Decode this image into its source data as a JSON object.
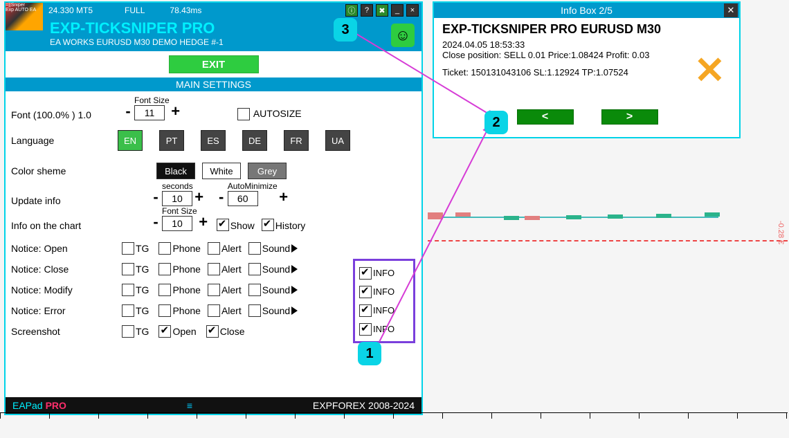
{
  "topbar": {
    "ver": "24.330 MT5",
    "mode": "FULL",
    "latency": "78.43ms"
  },
  "title": "EXP-TICKSNIPER PRO",
  "subtitle": "EA WORKS EURUSD M30 DEMO HEDGE  #-1",
  "exit": "EXIT",
  "section": "MAIN SETTINGS",
  "font": {
    "label": "Font  (100.0% ) 1.0",
    "hdr": "Font Size",
    "val": "11",
    "auto": "AUTOSIZE"
  },
  "lang": {
    "label": "Language",
    "items": [
      "EN",
      "PT",
      "ES",
      "DE",
      "FR",
      "UA"
    ]
  },
  "scheme": {
    "label": "Color sheme",
    "black": "Black",
    "white": "White",
    "grey": "Grey"
  },
  "update": {
    "label": "Update info",
    "secHdr": "seconds",
    "sec": "10",
    "amHdr": "AutoMinimize",
    "am": "60"
  },
  "infoChart": {
    "label": "Info on the chart",
    "hdr": "Font Size",
    "val": "10",
    "show": "Show",
    "hist": "History"
  },
  "notice": {
    "open": "Notice: Open",
    "close": "Notice: Close",
    "modify": "Notice: Modify",
    "error": "Notice: Error",
    "tg": "TG",
    "phone": "Phone",
    "alert": "Alert",
    "sound": "Sound",
    "info": "INFO"
  },
  "screenshot": {
    "label": "Screenshot",
    "tg": "TG",
    "open": "Open",
    "close": "Close"
  },
  "footer": {
    "ea": "EAPad",
    "pro": "PRO",
    "cr": "EXPFOREX 2008-2024"
  },
  "badges": {
    "b1": "1",
    "b2": "2",
    "b3": "3"
  },
  "infobox": {
    "title": "Info Box  2/5",
    "h1": "EXP-TICKSNIPER PRO EURUSD M30",
    "l1": "2024.04.05 18:53:33",
    "l2": "Close position: SELL 0.01 Price:1.08424 Profit: 0.03",
    "l3": "Ticket: 150131043106 SL:1.12924 TP:1.07524",
    "prev": "<",
    "next": ">"
  },
  "yNote": "-0.28 €"
}
